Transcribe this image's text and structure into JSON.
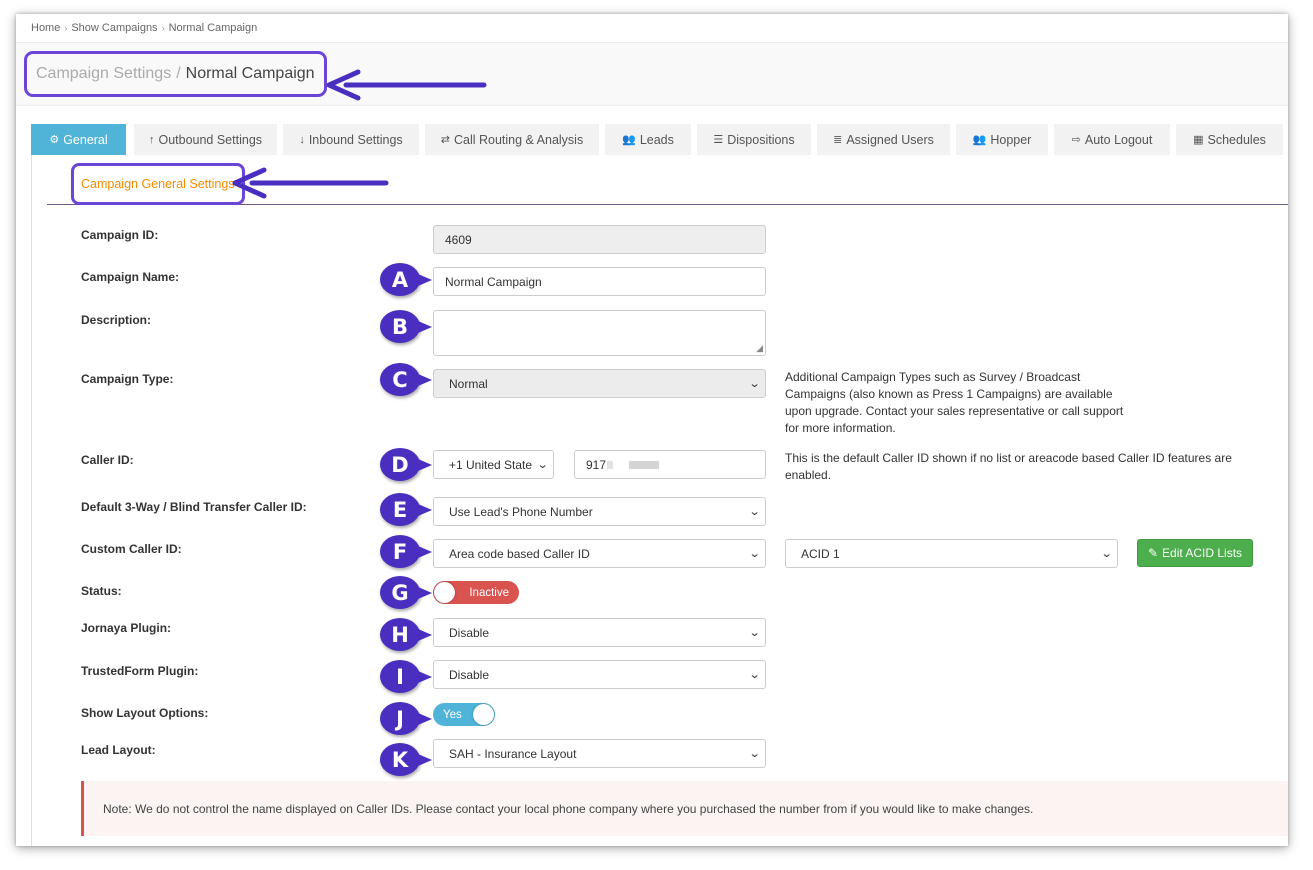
{
  "breadcrumb": {
    "items": [
      "Home",
      "Show Campaigns",
      "Normal Campaign"
    ]
  },
  "page_title": {
    "section": "Campaign Settings",
    "separator": "/",
    "name": "Normal Campaign"
  },
  "tabs": [
    {
      "label": "General",
      "icon": "cogs-icon",
      "active": true
    },
    {
      "label": "Outbound Settings",
      "icon": "arrow-up-icon"
    },
    {
      "label": "Inbound Settings",
      "icon": "arrow-down-icon"
    },
    {
      "label": "Call Routing & Analysis",
      "icon": "random-icon"
    },
    {
      "label": "Leads",
      "icon": "users-icon"
    },
    {
      "label": "Dispositions",
      "icon": "list-icon"
    },
    {
      "label": "Assigned Users",
      "icon": "list-ol-icon"
    },
    {
      "label": "Hopper",
      "icon": "users-icon"
    },
    {
      "label": "Auto Logout",
      "icon": "sign-out-icon"
    },
    {
      "label": "Schedules",
      "icon": "calendar-icon"
    }
  ],
  "section_title": "Campaign General Settings",
  "form": {
    "campaign_id": {
      "label": "Campaign ID:",
      "value": "4609"
    },
    "campaign_name": {
      "label": "Campaign Name:",
      "value": "Normal Campaign",
      "badge": "A"
    },
    "description": {
      "label": "Description:",
      "value": "",
      "badge": "B"
    },
    "campaign_type": {
      "label": "Campaign Type:",
      "value": "Normal",
      "badge": "C",
      "help": "Additional Campaign Types such as Survey / Broadcast Campaigns (also known as Press 1 Campaigns) are available upon upgrade. Contact your sales representative or call support for more information."
    },
    "caller_id": {
      "label": "Caller ID:",
      "country": "+1 United State",
      "number": "917",
      "badge": "D",
      "help": "This is the default Caller ID shown if no list or areacode based Caller ID features are enabled."
    },
    "transfer_caller_id": {
      "label": "Default 3-Way / Blind Transfer Caller ID:",
      "value": "Use Lead's Phone Number",
      "badge": "E"
    },
    "custom_caller_id": {
      "label": "Custom Caller ID:",
      "value": "Area code based Caller ID",
      "acid_value": "ACID 1",
      "button": "Edit ACID Lists",
      "badge": "F"
    },
    "status": {
      "label": "Status:",
      "value": "Inactive",
      "badge": "G"
    },
    "jornaya": {
      "label": "Jornaya Plugin:",
      "value": "Disable",
      "badge": "H"
    },
    "trustedform": {
      "label": "TrustedForm Plugin:",
      "value": "Disable",
      "badge": "I"
    },
    "layout_options": {
      "label": "Show Layout Options:",
      "value": "Yes",
      "badge": "J"
    },
    "lead_layout": {
      "label": "Lead Layout:",
      "value": "SAH - Insurance Layout",
      "badge": "K"
    }
  },
  "note": "Note: We do not control the name displayed on Caller IDs. Please contact your local phone company where you purchased the number from if you would like to make changes.",
  "colors": {
    "accent_purple": "#6a45d8",
    "badge_purple": "#4a2ec0",
    "tab_active": "#4fb4d8",
    "section_orange": "#f28c00",
    "danger": "#d9534f",
    "success": "#4cae4c"
  }
}
